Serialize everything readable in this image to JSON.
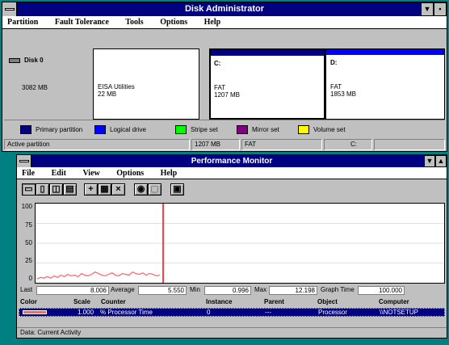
{
  "disk_admin": {
    "title": "Disk Administrator",
    "menu": [
      "Partition",
      "Fault Tolerance",
      "Tools",
      "Options",
      "Help"
    ],
    "disk": {
      "label": "Disk 0",
      "size": "3082 MB"
    },
    "partitions": [
      {
        "name": "",
        "fs": "EISA Utilities",
        "size": "22 MB"
      },
      {
        "name": "C:",
        "fs": "FAT",
        "size": "1207 MB"
      },
      {
        "name": "D:",
        "fs": "FAT",
        "size": "1853 MB"
      }
    ],
    "legend": [
      {
        "label": "Primary partition",
        "color": "#000080"
      },
      {
        "label": "Logical drive",
        "color": "#0000ff"
      },
      {
        "label": "Stripe set",
        "color": "#00ff00"
      },
      {
        "label": "Mirror set",
        "color": "#800080"
      },
      {
        "label": "Volume set",
        "color": "#ffff00"
      }
    ],
    "status": {
      "type": "Active partition",
      "size": "1207 MB",
      "fs": "FAT",
      "drive": "C:"
    }
  },
  "perf_mon": {
    "title": "Performance Monitor",
    "menu": [
      "File",
      "Edit",
      "View",
      "Options",
      "Help"
    ],
    "y_ticks": [
      "100",
      "75",
      "50",
      "25",
      "0"
    ],
    "stats": {
      "last_label": "Last",
      "last": "8.006",
      "avg_label": "Average",
      "avg": "5.550",
      "min_label": "Min",
      "min": "0.996",
      "max_label": "Max",
      "max": "12.198",
      "gt_label": "Graph Time",
      "gt": "100.000"
    },
    "columns": {
      "color": "Color",
      "scale": "Scale",
      "counter": "Counter",
      "instance": "Instance",
      "parent": "Parent",
      "object": "Object",
      "computer": "Computer"
    },
    "row": {
      "scale": "1.000",
      "counter": "% Processor Time",
      "instance": "0",
      "parent": "---",
      "object": "Processor",
      "computer": "\\\\NOTSETUP"
    },
    "status": "Data: Current Activity",
    "line_color": "#ff6060"
  },
  "chart_data": {
    "type": "line",
    "ylim": [
      0,
      100
    ],
    "x": [
      0,
      1,
      2,
      3,
      4,
      5,
      6,
      7,
      8,
      9,
      10,
      11,
      12,
      13,
      14,
      15,
      16,
      17,
      18,
      19,
      20,
      21,
      22,
      23,
      24,
      25,
      26,
      27,
      28,
      29,
      30,
      31,
      32,
      33,
      34,
      35,
      36,
      37
    ],
    "series": [
      {
        "values": [
          3,
          5,
          4,
          6,
          4,
          7,
          5,
          8,
          6,
          9,
          7,
          8,
          6,
          10,
          8,
          7,
          9,
          12,
          10,
          8,
          7,
          9,
          11,
          8,
          7,
          10,
          9,
          8,
          12,
          10,
          9,
          11,
          8,
          10,
          9,
          7,
          8,
          100
        ]
      }
    ]
  }
}
